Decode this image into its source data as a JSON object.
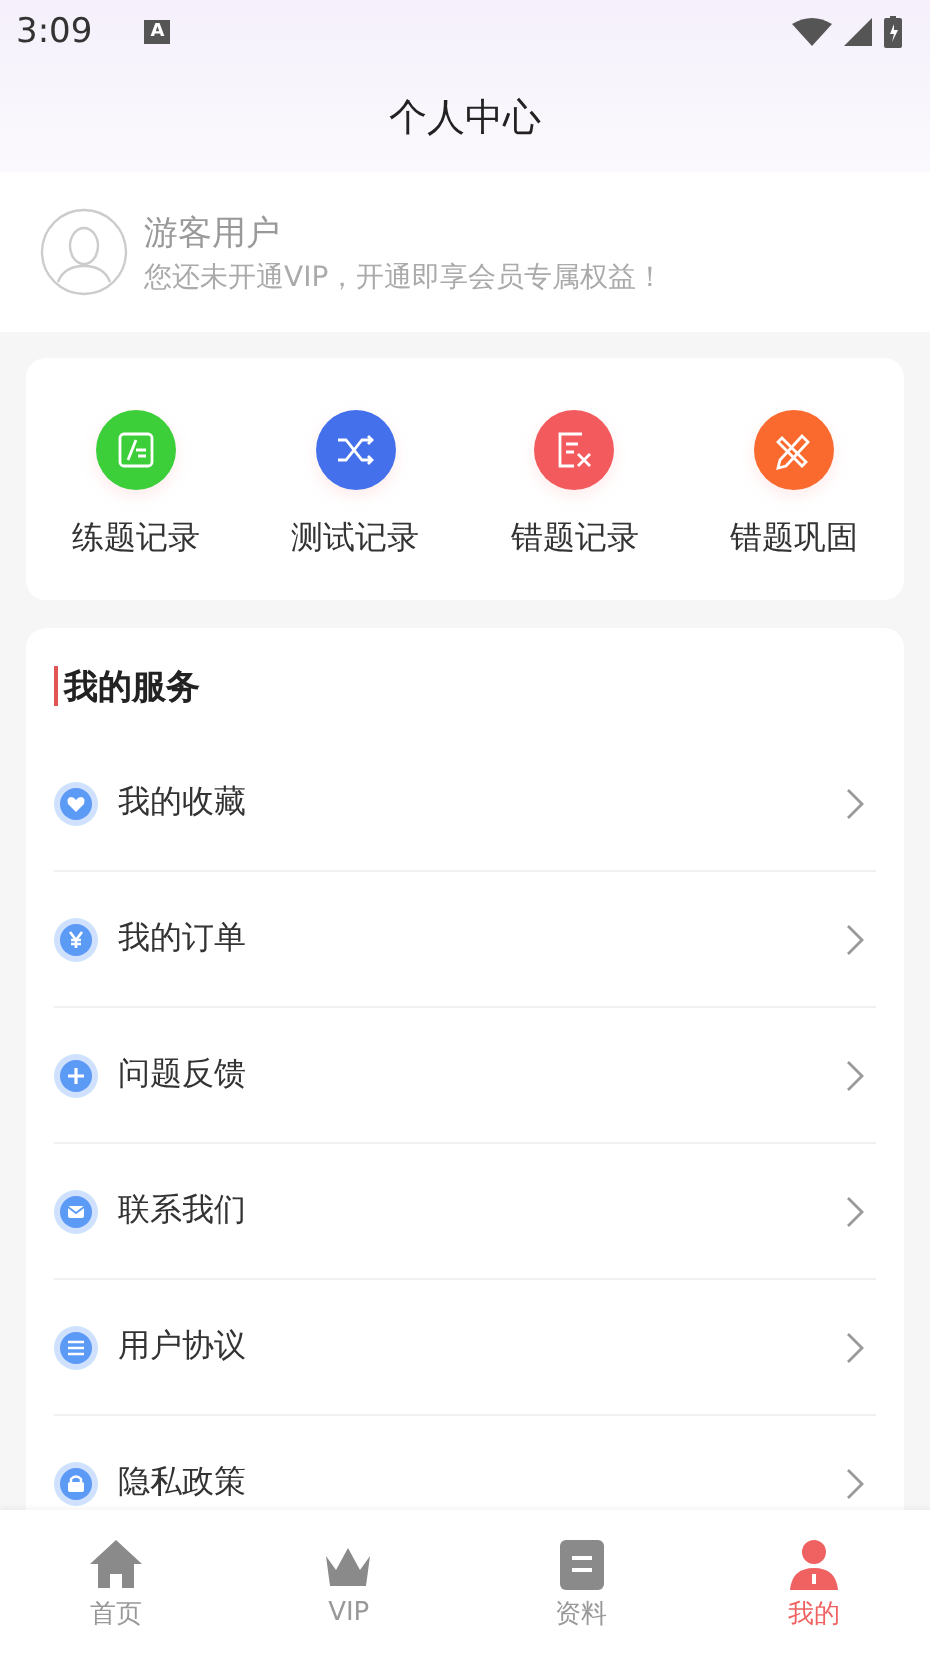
{
  "status_bar": {
    "time": "3:09",
    "notification": "A"
  },
  "header": {
    "title": "个人中心"
  },
  "profile": {
    "name": "游客用户",
    "subtitle": "您还未开通VIP，开通即享会员专属权益！"
  },
  "shortcuts": [
    {
      "label": "练题记录",
      "kind": "practice",
      "color": "#3ccf3a"
    },
    {
      "label": "测试记录",
      "kind": "shuffle",
      "color": "#4470ec"
    },
    {
      "label": "错题记录",
      "kind": "wrong",
      "color": "#f35a5e"
    },
    {
      "label": "错题巩固",
      "kind": "pencil",
      "color": "#fa6a2e"
    }
  ],
  "services": {
    "title": "我的服务",
    "items": [
      {
        "label": "我的收藏",
        "kind": "heart"
      },
      {
        "label": "我的订单",
        "kind": "yen"
      },
      {
        "label": "问题反馈",
        "kind": "plus"
      },
      {
        "label": "联系我们",
        "kind": "mail"
      },
      {
        "label": "用户协议",
        "kind": "list"
      },
      {
        "label": "隐私政策",
        "kind": "lock"
      }
    ]
  },
  "tab_bar": [
    {
      "label": "首页",
      "kind": "home",
      "selected": false
    },
    {
      "label": "VIP",
      "kind": "crown",
      "selected": false
    },
    {
      "label": "资料",
      "kind": "doc",
      "selected": false
    },
    {
      "label": "我的",
      "kind": "person",
      "selected": true
    }
  ]
}
